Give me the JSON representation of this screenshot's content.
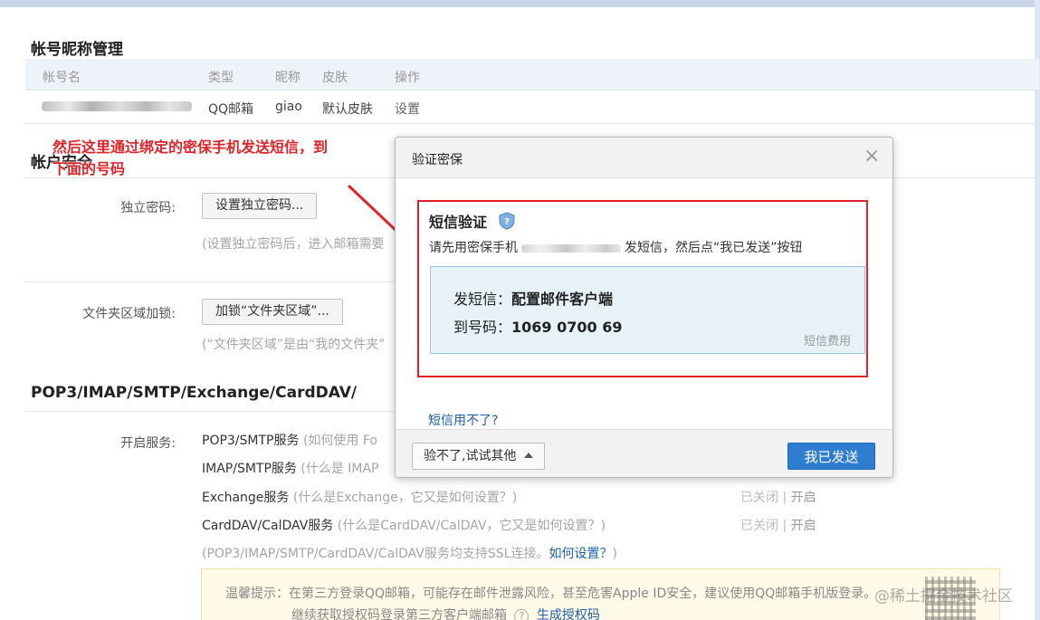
{
  "account_section": {
    "title": "帐号昵称管理",
    "columns": [
      "帐号名",
      "类型",
      "昵称",
      "皮肤",
      "操作"
    ],
    "row": {
      "type": "QQ邮箱",
      "nickname": "giao",
      "skin": "默认皮肤",
      "action": "设置"
    }
  },
  "security_section": {
    "title": "帐户安全",
    "independent_password": {
      "label": "独立密码:",
      "button": "设置独立密码...",
      "hint": "(设置独立密码后，进入邮箱需要"
    },
    "folder_lock": {
      "label": "文件夹区域加锁:",
      "button": "加锁“文件夹区域”...",
      "hint": "(“文件夹区域”是由“我的文件夹”"
    }
  },
  "protocol_section": {
    "title": "POP3/IMAP/SMTP/Exchange/CardDAV/",
    "open_service_label": "开启服务:",
    "services": [
      {
        "name": "POP3/SMTP服务",
        "question": "(如何使用 Fo"
      },
      {
        "name": "IMAP/SMTP服务",
        "question": "(什么是 IMAP"
      },
      {
        "name": "Exchange服务",
        "question": "(什么是Exchange，它又是如何设置？)",
        "status_off": "已关闭",
        "sep": "|",
        "status_on": "开启"
      },
      {
        "name": "CardDAV/CalDAV服务",
        "question": "(什么是CardDAV/CalDAV，它又是如何设置？)",
        "status_off": "已关闭",
        "sep": "|",
        "status_on": "开启"
      }
    ],
    "ssl_note": "(POP3/IMAP/SMTP/CardDAV/CalDAV服务均支持SSL连接。",
    "ssl_link": "如何设置？",
    "ssl_close": ")"
  },
  "tip": {
    "line1": "温馨提示：在第三方登录QQ邮箱，可能存在邮件泄露风险，甚至危害Apple ID安全，建议使用QQ邮箱手机版登录。",
    "line2_prefix": "继续获取授权码登录第三方客户端邮箱",
    "help_icon": "?",
    "line2_link": "生成授权码"
  },
  "dialog": {
    "title": "验证密保",
    "close": "×",
    "sms_title": "短信验证",
    "desc_prefix": "请先用密保手机",
    "desc_suffix": "发短信，然后点“我已发送”按钮",
    "send_label": "发短信：",
    "send_value": "配置邮件客户端",
    "to_label": "到号码：",
    "to_value": "1069 0700 69",
    "fee_link": "短信费用",
    "cant_use": "短信用不了?",
    "alt_button": "验不了,试试其他",
    "confirm_button": "我已发送"
  },
  "annotation": {
    "line1": "然后这里通过绑定的密保手机发送短信，到",
    "line2": "下面的号码"
  },
  "watermark": "@稀土掘金技术社区",
  "colors": {
    "annotation_red": "#e0242a",
    "primary_blue": "#2f7dd1",
    "link_blue": "#1d61aa"
  }
}
